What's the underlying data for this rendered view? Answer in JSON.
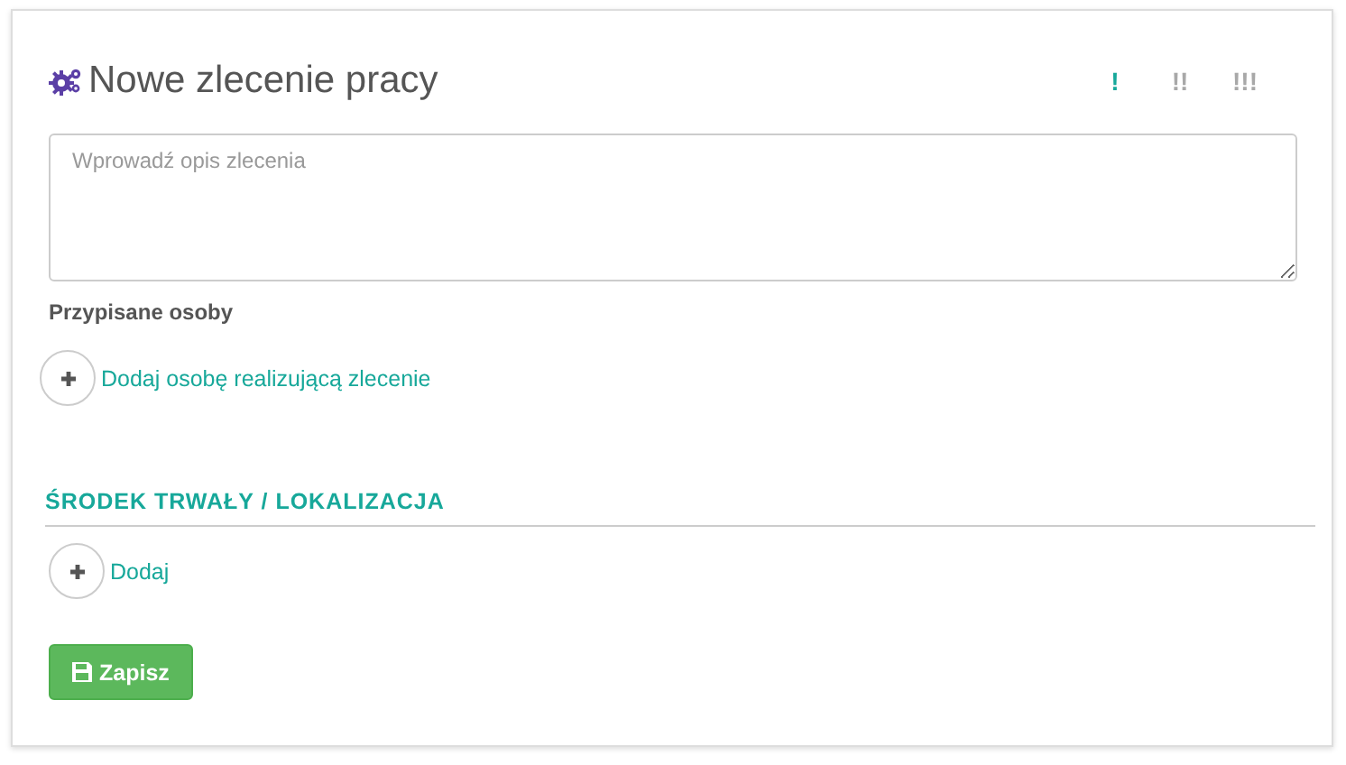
{
  "title": "Nowe zlecenie pracy",
  "priorities": [
    {
      "label": "!",
      "selected": true
    },
    {
      "label": "!!",
      "selected": false
    },
    {
      "label": "!!!",
      "selected": false
    }
  ],
  "description": {
    "placeholder": "Wprowadź opis zlecenia"
  },
  "assigned": {
    "label": "Przypisane osoby",
    "add_link": "Dodaj osobę realizującą zlecenie"
  },
  "asset_section": {
    "heading": "ŚRODEK TRWAŁY / LOKALIZACJA",
    "add_link": "Dodaj"
  },
  "save_button": "Zapisz"
}
